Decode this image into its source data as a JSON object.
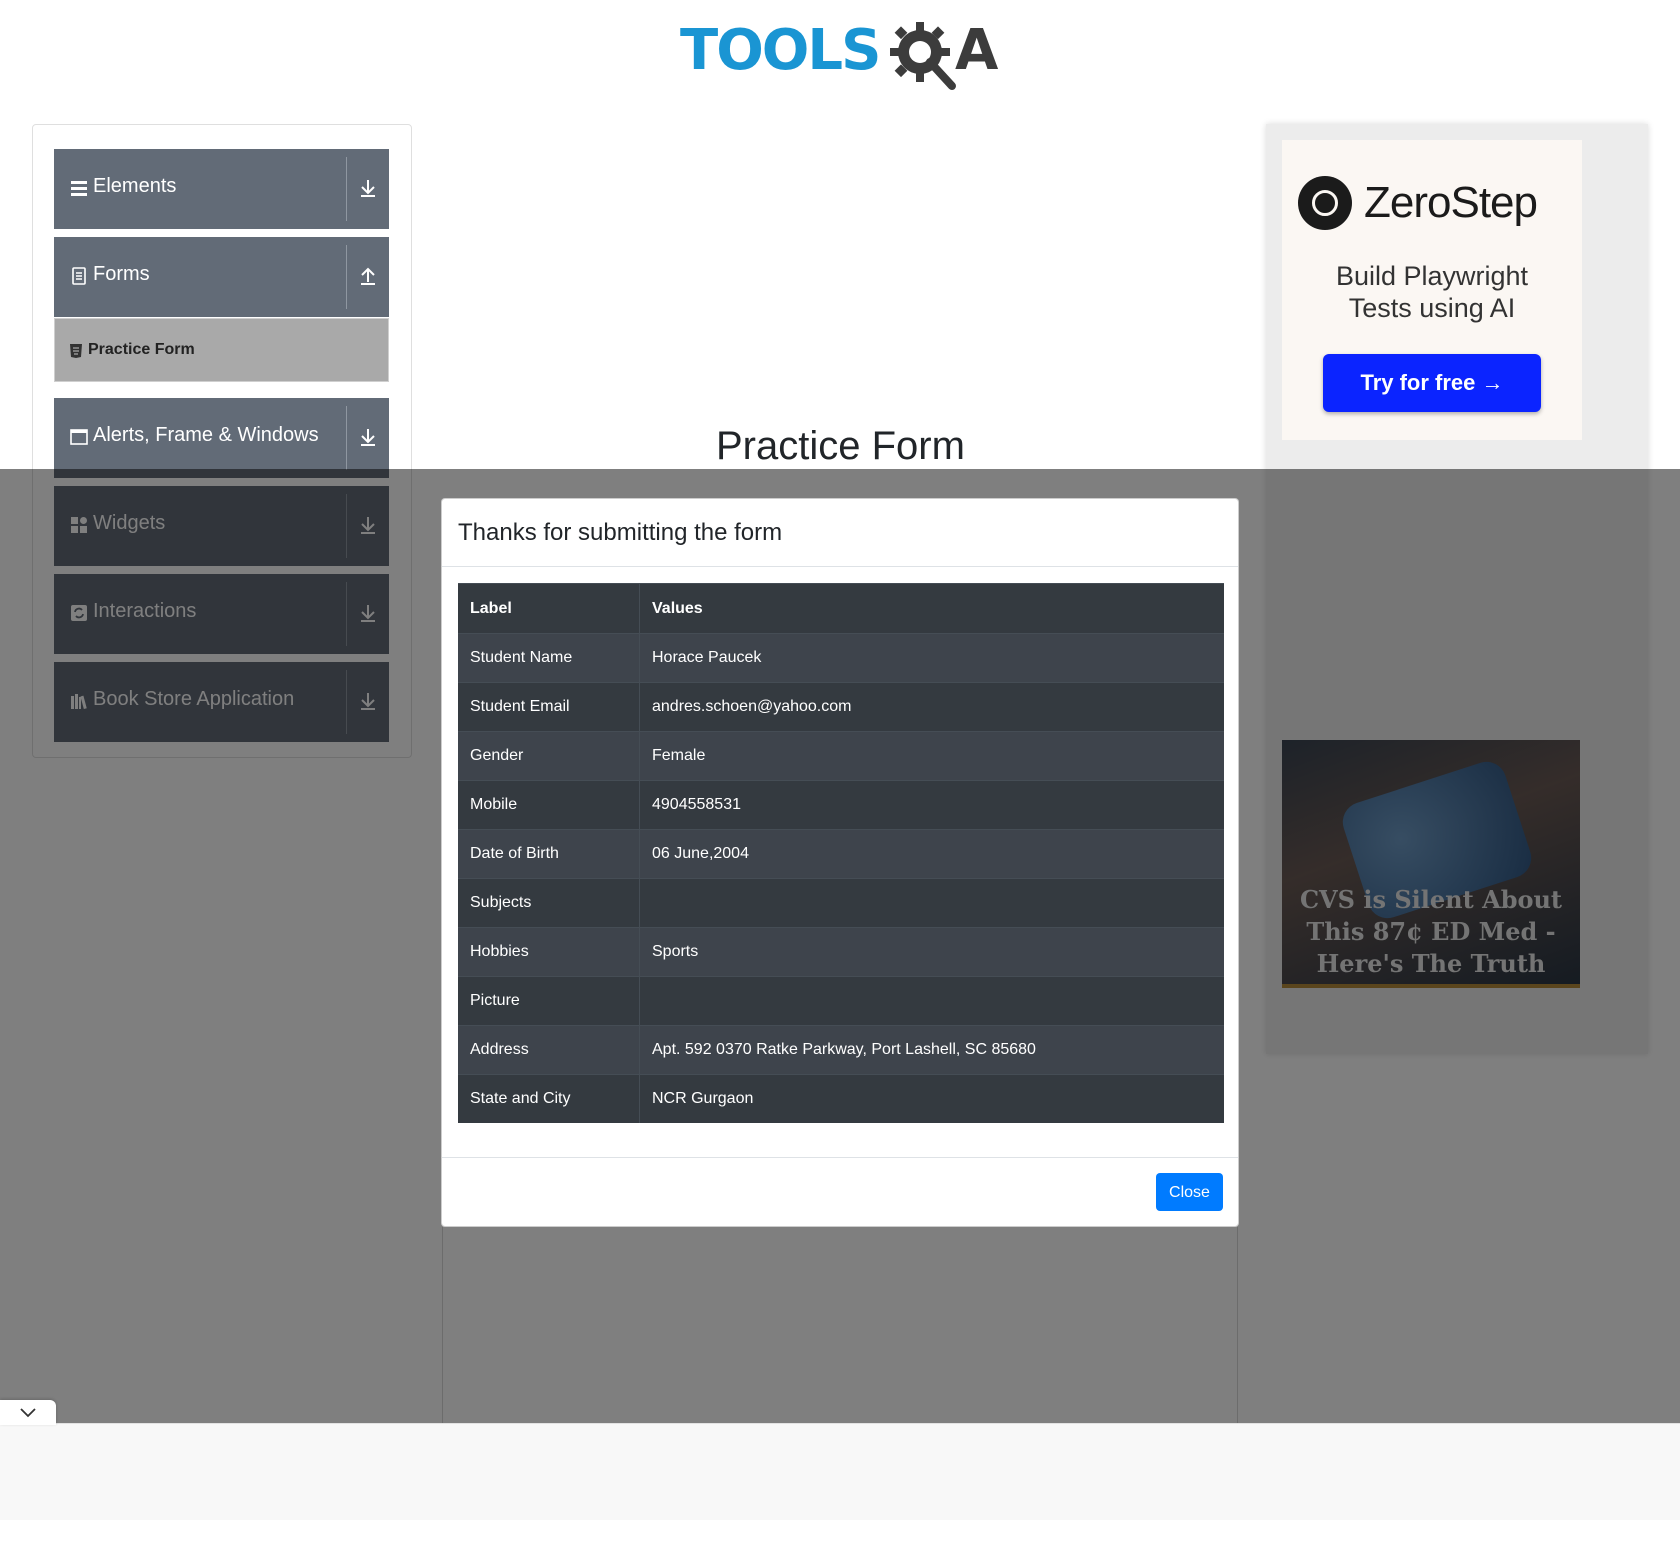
{
  "header": {
    "logo_text_left": "TOOLS",
    "logo_text_right": "A"
  },
  "sidebar": {
    "groups": [
      {
        "label": "Elements",
        "icon": "hamburger-icon",
        "arrow": "download-arrow-icon"
      },
      {
        "label": "Forms",
        "icon": "document-icon",
        "arrow": "upload-arrow-icon"
      },
      {
        "label": "Alerts, Frame & Windows",
        "icon": "window-icon",
        "arrow": "download-arrow-icon"
      },
      {
        "label": "Widgets",
        "icon": "widgets-icon",
        "arrow": "download-arrow-icon"
      },
      {
        "label": "Interactions",
        "icon": "interactions-icon",
        "arrow": "download-arrow-icon"
      },
      {
        "label": "Book Store Application",
        "icon": "books-icon",
        "arrow": "download-arrow-icon"
      }
    ],
    "active_item": "Practice Form"
  },
  "main": {
    "title": "Practice Form"
  },
  "modal": {
    "title": "Thanks for submitting the form",
    "columns": [
      "Label",
      "Values"
    ],
    "rows": [
      [
        "Student Name",
        "Horace Paucek"
      ],
      [
        "Student Email",
        "andres.schoen@yahoo.com"
      ],
      [
        "Gender",
        "Female"
      ],
      [
        "Mobile",
        "4904558531"
      ],
      [
        "Date of Birth",
        "06 June,2004"
      ],
      [
        "Subjects",
        ""
      ],
      [
        "Hobbies",
        "Sports"
      ],
      [
        "Picture",
        ""
      ],
      [
        "Address",
        "Apt. 592 0370 Ratke Parkway, Port Lashell, SC 85680"
      ],
      [
        "State and City",
        "NCR Gurgaon"
      ]
    ],
    "close_label": "Close"
  },
  "ads": {
    "zerostep_name": "ZeroStep",
    "zerostep_tagline": "Build Playwright Tests using AI",
    "zerostep_cta": "Try for free →",
    "ad2_text": "CVS is Silent About This 87¢ ED Med - Here's The Truth"
  },
  "colors": {
    "brand_blue": "#1a95d3",
    "nav_group_bg": "#626b77",
    "primary_button": "#007bff",
    "table_dark": "#343a40"
  }
}
